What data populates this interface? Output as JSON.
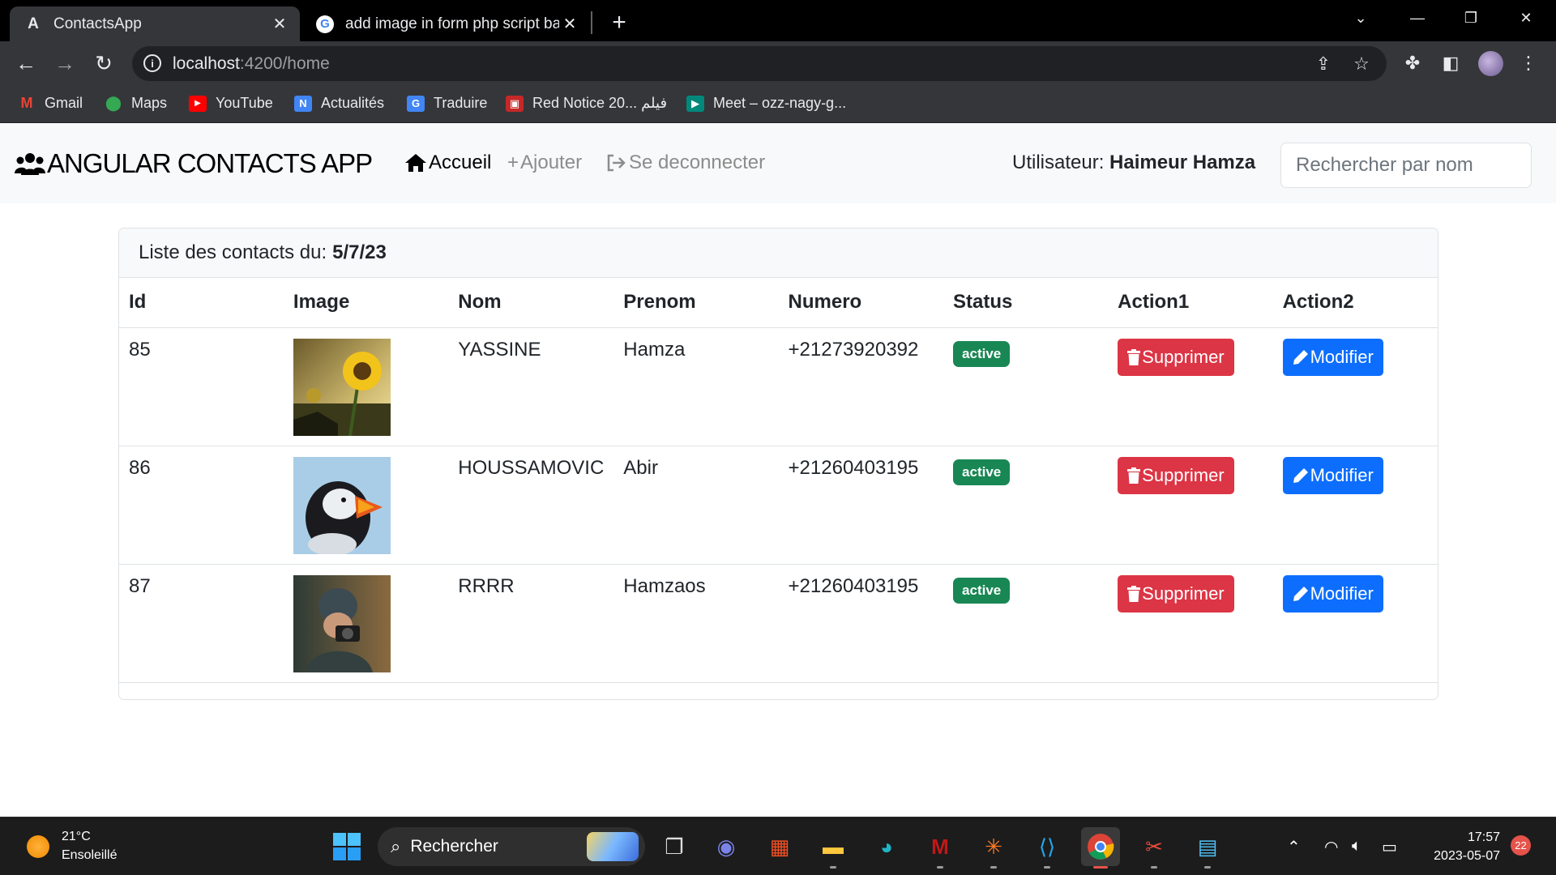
{
  "browser": {
    "tabs": [
      {
        "title": "ContactsApp",
        "active": true,
        "favicon": "angular-icon"
      },
      {
        "title": "add image in form php script ba",
        "active": false,
        "favicon": "google-icon"
      }
    ],
    "address": {
      "host": "localhost",
      "path": ":4200/home"
    },
    "bookmarks": [
      {
        "label": "Gmail",
        "icon": "gmail-icon",
        "color": "#ea4335"
      },
      {
        "label": "Maps",
        "icon": "maps-icon",
        "color": "#34a853"
      },
      {
        "label": "YouTube",
        "icon": "youtube-icon",
        "color": "#ff0000"
      },
      {
        "label": "Actualités",
        "icon": "news-icon",
        "color": "#4285f4"
      },
      {
        "label": "Traduire",
        "icon": "translate-icon",
        "color": "#4285f4"
      },
      {
        "label": "Red Notice 20... فيلم",
        "icon": "movie-icon",
        "color": "#c62828"
      },
      {
        "label": "Meet – ozz-nagy-g...",
        "icon": "meet-icon",
        "color": "#00897b"
      }
    ]
  },
  "app": {
    "brand": "ANGULAR CONTACTS APP",
    "nav": {
      "home": "Accueil",
      "add": "Ajouter",
      "logout": "Se deconnecter"
    },
    "user_label": "Utilisateur:",
    "user_name": "Haimeur Hamza",
    "search_placeholder": "Rechercher par nom"
  },
  "contacts_card": {
    "header_label": "Liste des contacts du:",
    "date": "5/7/23",
    "columns": [
      "Id",
      "Image",
      "Nom",
      "Prenom",
      "Numero",
      "Status",
      "Action1",
      "Action2"
    ],
    "rows": [
      {
        "id": "85",
        "image": "sunflower",
        "nom": "YASSINE",
        "prenom": "Hamza",
        "numero": "+21273920392",
        "status": "active",
        "delete": "Supprimer",
        "edit": "Modifier"
      },
      {
        "id": "86",
        "image": "puffin",
        "nom": "HOUSSAMOVIC",
        "prenom": "Abir",
        "numero": "+21260403195",
        "status": "active",
        "delete": "Supprimer",
        "edit": "Modifier"
      },
      {
        "id": "87",
        "image": "photographer",
        "nom": "RRRR",
        "prenom": "Hamzaos",
        "numero": "+21260403195",
        "status": "active",
        "delete": "Supprimer",
        "edit": "Modifier"
      }
    ]
  },
  "taskbar": {
    "weather_temp": "21°C",
    "weather_desc": "Ensoleillé",
    "search_label": "Rechercher",
    "time": "17:57",
    "date": "2023-05-07",
    "notifications": "22"
  },
  "colors": {
    "danger": "#dc3545",
    "primary": "#0d6efd",
    "success": "#198754",
    "navbar_bg": "#f8f9fa"
  }
}
